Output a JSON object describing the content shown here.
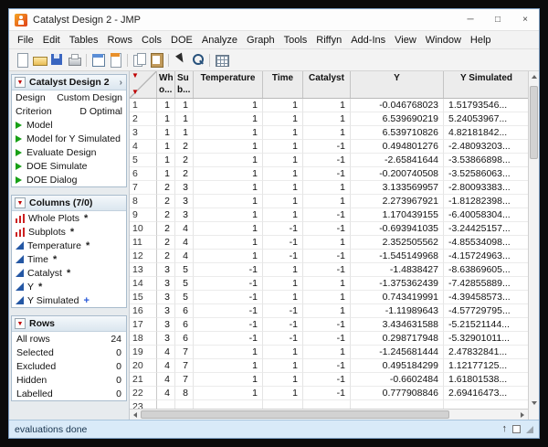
{
  "titlebar": {
    "title": "Catalyst Design 2 - JMP",
    "buttons": [
      "minimize",
      "maximize",
      "close"
    ]
  },
  "menu": {
    "items": [
      "File",
      "Edit",
      "Tables",
      "Rows",
      "Cols",
      "DOE",
      "Analyze",
      "Graph",
      "Tools",
      "Riffyn",
      "Add-Ins",
      "View",
      "Window",
      "Help"
    ]
  },
  "toolbar": {
    "items": [
      "new-icon",
      "open-icon",
      "save-icon",
      "print-icon",
      "separator",
      "data-table-icon",
      "journal-icon",
      "separator",
      "copy-icon",
      "paste-icon",
      "separator",
      "cursor-icon",
      "magnifier-icon",
      "separator",
      "grid-icon"
    ]
  },
  "sidebar": {
    "design_panel": {
      "title": "Catalyst Design 2",
      "properties": [
        {
          "label": "Design",
          "value": "Custom Design"
        },
        {
          "label": "Criterion",
          "value": "D Optimal"
        }
      ],
      "scripts": [
        "Model",
        "Model for Y Simulated",
        "Evaluate Design",
        "DOE Simulate",
        "DOE Dialog"
      ]
    },
    "columns_panel": {
      "title": "Columns (7/0)",
      "items": [
        {
          "name": "Whole Plots",
          "icon": "nominal-bars-icon",
          "marker": "*"
        },
        {
          "name": "Subplots",
          "icon": "nominal-bars-icon",
          "marker": "*"
        },
        {
          "name": "Temperature",
          "icon": "continuous-icon",
          "marker": "*"
        },
        {
          "name": "Time",
          "icon": "continuous-icon",
          "marker": "*"
        },
        {
          "name": "Catalyst",
          "icon": "continuous-icon",
          "marker": "*"
        },
        {
          "name": "Y",
          "icon": "continuous-icon",
          "marker": "*"
        },
        {
          "name": "Y Simulated",
          "icon": "continuous-icon",
          "marker": "+"
        }
      ]
    },
    "rows_panel": {
      "title": "Rows",
      "stats": [
        {
          "label": "All rows",
          "value": "24"
        },
        {
          "label": "Selected",
          "value": "0"
        },
        {
          "label": "Excluded",
          "value": "0"
        },
        {
          "label": "Hidden",
          "value": "0"
        },
        {
          "label": "Labelled",
          "value": "0"
        }
      ]
    }
  },
  "table": {
    "headers": [
      "Wh o...",
      "Su b...",
      "Temperature",
      "Time",
      "Catalyst",
      "Y",
      "Y Simulated"
    ],
    "rows": [
      [
        1,
        1,
        1,
        1,
        1,
        1,
        "-0.046768023",
        "1.51793546..."
      ],
      [
        2,
        1,
        1,
        1,
        1,
        1,
        "6.539690219",
        "5.24053967..."
      ],
      [
        3,
        1,
        1,
        1,
        1,
        1,
        "6.539710826",
        "4.82181842..."
      ],
      [
        4,
        1,
        2,
        1,
        1,
        -1,
        "0.494801276",
        "-2.48093203..."
      ],
      [
        5,
        1,
        2,
        1,
        1,
        -1,
        "-2.65841644",
        "-3.53866898..."
      ],
      [
        6,
        1,
        2,
        1,
        1,
        -1,
        "-0.200740508",
        "-3.52586063..."
      ],
      [
        7,
        2,
        3,
        1,
        1,
        1,
        "3.133569957",
        "-2.80093383..."
      ],
      [
        8,
        2,
        3,
        1,
        1,
        1,
        "2.273967921",
        "-1.81282398..."
      ],
      [
        9,
        2,
        3,
        1,
        1,
        -1,
        "1.170439155",
        "-6.40058304..."
      ],
      [
        10,
        2,
        4,
        1,
        -1,
        -1,
        "-0.693941035",
        "-3.24425157..."
      ],
      [
        11,
        2,
        4,
        1,
        -1,
        1,
        "2.352505562",
        "-4.85534098..."
      ],
      [
        12,
        2,
        4,
        1,
        -1,
        -1,
        "-1.545149968",
        "-4.15724963..."
      ],
      [
        13,
        3,
        5,
        -1,
        1,
        -1,
        "-1.4838427",
        "-8.63869605..."
      ],
      [
        14,
        3,
        5,
        -1,
        1,
        1,
        "-1.375362439",
        "-7.42855889..."
      ],
      [
        15,
        3,
        5,
        -1,
        1,
        1,
        "0.743419991",
        "-4.39458573..."
      ],
      [
        16,
        3,
        6,
        -1,
        -1,
        1,
        "-1.11989643",
        "-4.57729795..."
      ],
      [
        17,
        3,
        6,
        -1,
        -1,
        -1,
        "3.434631588",
        "-5.21521144..."
      ],
      [
        18,
        3,
        6,
        -1,
        -1,
        -1,
        "0.298717948",
        "-5.32901011..."
      ],
      [
        19,
        4,
        7,
        1,
        1,
        1,
        "-1.245681444",
        "2.47832841..."
      ],
      [
        20,
        4,
        7,
        1,
        1,
        -1,
        "0.495184299",
        "1.12177125..."
      ],
      [
        21,
        4,
        7,
        1,
        1,
        -1,
        "-0.6602484",
        "1.61801538..."
      ],
      [
        22,
        4,
        8,
        1,
        1,
        -1,
        "0.777908846",
        "2.69416473..."
      ],
      [
        23,
        "",
        "",
        "",
        "",
        "",
        "",
        ""
      ]
    ]
  },
  "statusbar": {
    "text": "evaluations done"
  },
  "colors": {
    "red_triangle": "#c00000",
    "continuous_blue": "#2457a4",
    "nominal_red": "#cc2222",
    "script_green": "#17a017",
    "status_bg": "#d9eaf8"
  }
}
